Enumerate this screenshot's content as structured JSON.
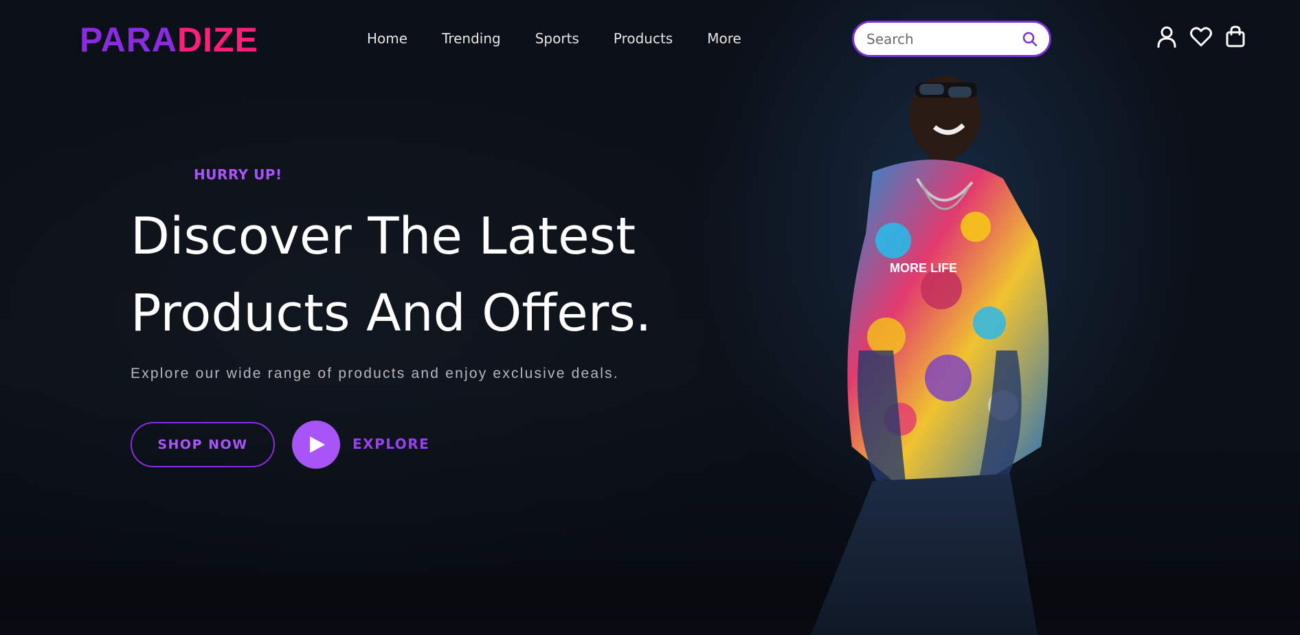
{
  "brand": {
    "part1": "PARA",
    "part2": "DIZE",
    "color1": "#8a2be2",
    "color2": "#ff1f7a"
  },
  "nav": {
    "items": [
      "Home",
      "Trending",
      "Sports",
      "Products",
      "More"
    ]
  },
  "search": {
    "placeholder": "Search",
    "value": ""
  },
  "header_icons": [
    "user-icon",
    "heart-icon",
    "shopping-bag-icon"
  ],
  "hero": {
    "eyebrow": "HURRY UP!",
    "title_line1": "Discover The Latest",
    "title_line2": "Products And Offers.",
    "subtitle": "Explore our wide range of products and enjoy exclusive deals.",
    "shop_label": "SHOP NOW",
    "explore_label": "EXPLORE",
    "hoodie_text": "MORE LIFE"
  },
  "colors": {
    "accent": "#a855f7",
    "accent_dark": "#8a2be2",
    "background": "#0a0e16"
  }
}
